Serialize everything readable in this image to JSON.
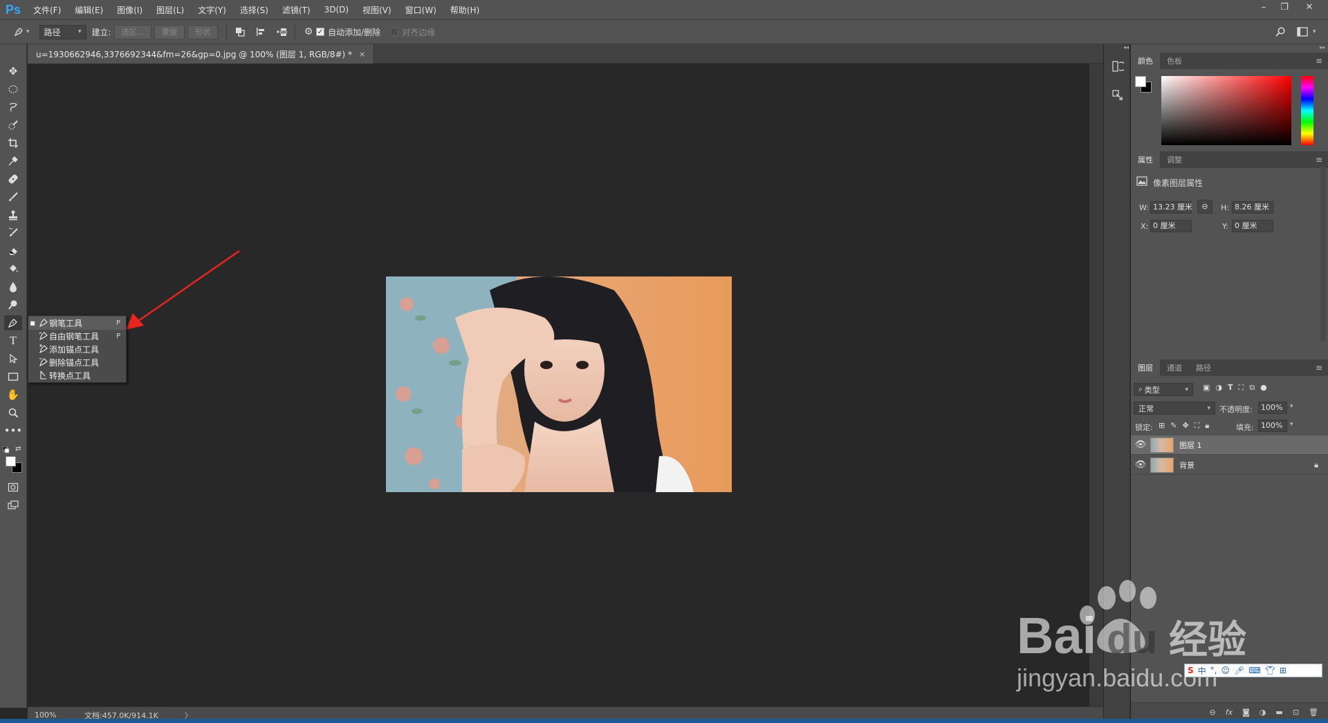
{
  "app": {
    "logo": "Ps"
  },
  "menu": [
    "文件(F)",
    "编辑(E)",
    "图像(I)",
    "图层(L)",
    "文字(Y)",
    "选择(S)",
    "滤镜(T)",
    "3D(D)",
    "视图(V)",
    "窗口(W)",
    "帮助(H)"
  ],
  "window_controls": {
    "minimize": "–",
    "restore": "❐",
    "close": "✕"
  },
  "options": {
    "mode_value": "路径",
    "make_label": "建立:",
    "make_selection": "选区...",
    "make_mask": "蒙版",
    "make_shape": "形状",
    "auto_add_delete_label": "自动添加/删除",
    "auto_add_delete_checked": true,
    "align_edges_label": "对齐边缘",
    "align_edges_checked": false
  },
  "document": {
    "tab_title": "u=1930662946,3376692344&fm=26&gp=0.jpg @ 100% (图层 1, RGB/8#) *",
    "close_label": "×"
  },
  "status": {
    "zoom": "100%",
    "doc_size": "文档:457.0K/914.1K",
    "arrow": "〉"
  },
  "tool_flyout": [
    {
      "label": "钢笔工具",
      "shortcut": "P",
      "active": true,
      "icon": "pen-icon"
    },
    {
      "label": "自由钢笔工具",
      "shortcut": "P",
      "active": false,
      "icon": "freeform-pen-icon"
    },
    {
      "label": "添加锚点工具",
      "shortcut": "",
      "active": false,
      "icon": "add-anchor-icon"
    },
    {
      "label": "删除锚点工具",
      "shortcut": "",
      "active": false,
      "icon": "delete-anchor-icon"
    },
    {
      "label": "转换点工具",
      "shortcut": "",
      "active": false,
      "icon": "convert-point-icon"
    }
  ],
  "color_panel": {
    "tabs": [
      "颜色",
      "色板"
    ]
  },
  "properties_panel": {
    "tabs": [
      "属性",
      "调整"
    ],
    "heading": "像素图层属性",
    "w_label": "W:",
    "w_value": "13.23 厘米",
    "h_label": "H:",
    "h_value": "8.26 厘米",
    "x_label": "X:",
    "x_value": "0 厘米",
    "y_label": "Y:",
    "y_value": "0 厘米"
  },
  "layers_panel": {
    "tabs": [
      "图层",
      "通道",
      "路径"
    ],
    "filter_kind": "类型",
    "blend_mode": "正常",
    "opacity_label": "不透明度:",
    "opacity_value": "100%",
    "lock_label": "锁定:",
    "fill_label": "填充:",
    "fill_value": "100%",
    "layers": [
      {
        "name": "图层 1",
        "selected": true,
        "locked": false
      },
      {
        "name": "背景",
        "selected": false,
        "locked": true
      }
    ]
  },
  "watermark": {
    "brand_a": "Bai",
    "brand_b": "du",
    "brand_c": "经验",
    "url": "jingyan.baidu.com"
  },
  "colors": {
    "accent": "#31a8ff",
    "annotation_arrow": "#e8251f",
    "panel": "#535353",
    "canvas": "#282828"
  }
}
